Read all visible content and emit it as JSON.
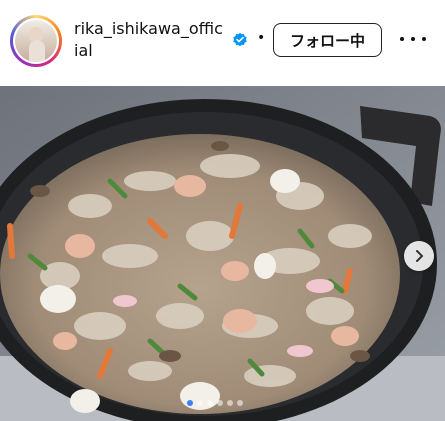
{
  "post": {
    "username": "rika_ishikawa_official",
    "verified": true,
    "separator": "•",
    "follow_label": "フォロー中",
    "more_icon": "more-horizontal-icon"
  },
  "carousel": {
    "next_icon": "chevron-right-icon",
    "slide_count": 6,
    "active_index": 0
  },
  "colors": {
    "verified_blue": "#0095f6",
    "active_dot": "#3b82f6"
  }
}
